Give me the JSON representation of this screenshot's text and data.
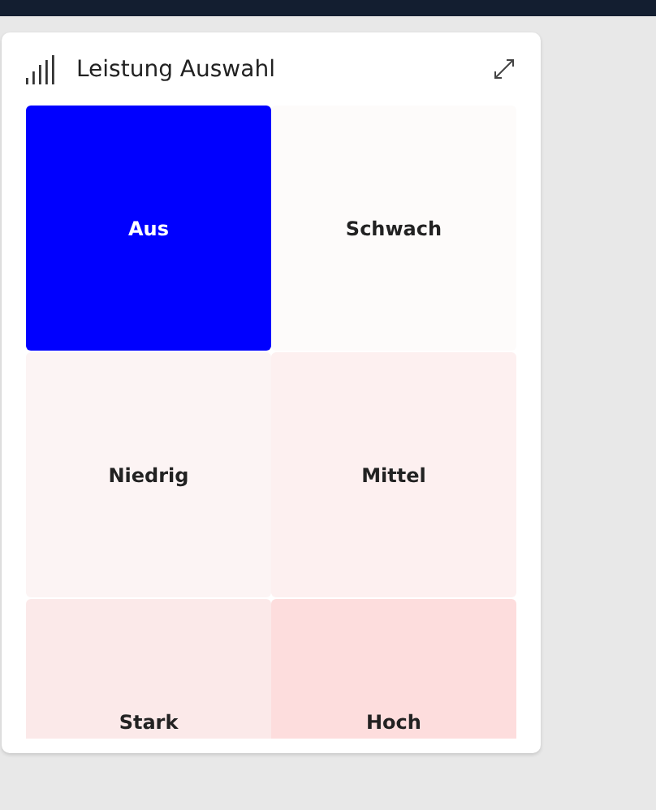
{
  "card": {
    "title": "Leistung Auswahl"
  },
  "options": [
    {
      "label": "Aus",
      "selected": true,
      "color": "#0000ff"
    },
    {
      "label": "Schwach",
      "selected": false,
      "color": "#fdfbfa"
    },
    {
      "label": "Niedrig",
      "selected": false,
      "color": "#fcf4f4"
    },
    {
      "label": "Mittel",
      "selected": false,
      "color": "#fdf0f0"
    },
    {
      "label": "Stark",
      "selected": false,
      "color": "#fbe9e9"
    },
    {
      "label": "Hoch",
      "selected": false,
      "color": "#fddddd"
    }
  ]
}
